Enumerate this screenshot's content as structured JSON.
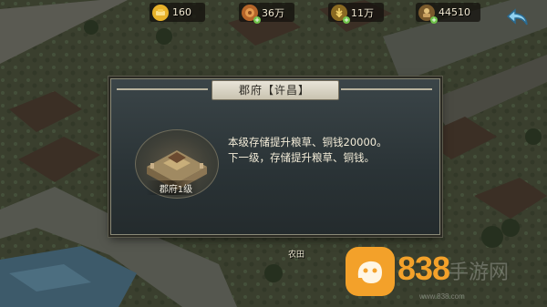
{
  "resources": [
    {
      "name": "gold-icon",
      "value": "160",
      "color": "#e8b22a",
      "plus": false
    },
    {
      "name": "food-icon",
      "value": "36万",
      "color": "#d98a3a",
      "plus": true
    },
    {
      "name": "grain-icon",
      "value": "11万",
      "color": "#d8b84a",
      "plus": true
    },
    {
      "name": "coin-icon",
      "value": "44510",
      "color": "#c9a14a",
      "plus": true
    }
  ],
  "dialog": {
    "title": "郡府【许昌】",
    "building_label": "郡府1级",
    "description_lines": [
      "本级存储提升粮草、铜钱20000。",
      "下一级，存储提升粮草、铜钱。"
    ]
  },
  "map": {
    "farm_label": "农田"
  },
  "watermark": {
    "number": "838",
    "chinese": "手游网",
    "url": "www.838.com"
  },
  "colors": {
    "accent": "#f3a12a",
    "dialog_bg": "#2f383b",
    "text": "#f3ecd8"
  }
}
